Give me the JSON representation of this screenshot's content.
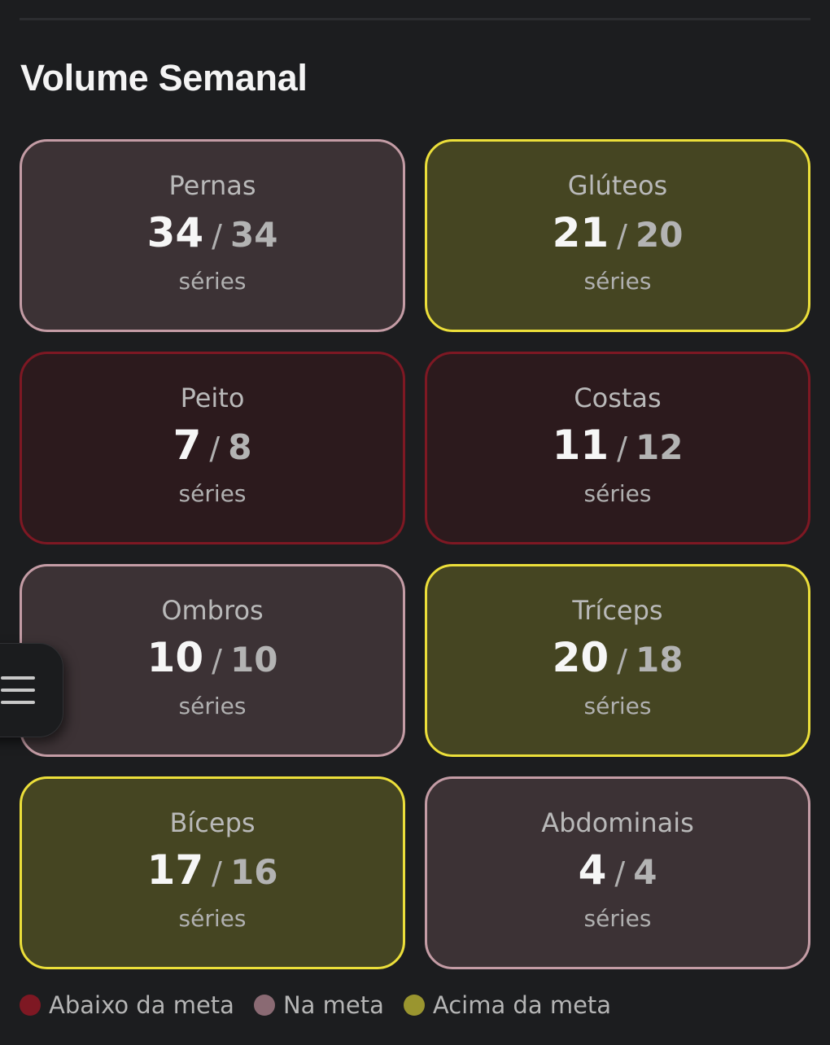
{
  "header": {
    "title": "Volume Semanal"
  },
  "colors": {
    "below": "#7e1823",
    "on_target": "#8a6a73",
    "above": "#9a952f"
  },
  "cards": [
    {
      "name": "Pernas",
      "done": "34",
      "target": "34",
      "unit": "séries",
      "status": "on"
    },
    {
      "name": "Glúteos",
      "done": "21",
      "target": "20",
      "unit": "séries",
      "status": "above"
    },
    {
      "name": "Peito",
      "done": "7",
      "target": "8",
      "unit": "séries",
      "status": "below"
    },
    {
      "name": "Costas",
      "done": "11",
      "target": "12",
      "unit": "séries",
      "status": "below"
    },
    {
      "name": "Ombros",
      "done": "10",
      "target": "10",
      "unit": "séries",
      "status": "on"
    },
    {
      "name": "Tríceps",
      "done": "20",
      "target": "18",
      "unit": "séries",
      "status": "above"
    },
    {
      "name": "Bíceps",
      "done": "17",
      "target": "16",
      "unit": "séries",
      "status": "above"
    },
    {
      "name": "Abdominais",
      "done": "4",
      "target": "4",
      "unit": "séries",
      "status": "on"
    }
  ],
  "separator": "/",
  "legend": [
    {
      "label": "Abaixo da meta",
      "color": "#7e1823"
    },
    {
      "label": "Na meta",
      "color": "#8a6a73"
    },
    {
      "label": "Acima da meta",
      "color": "#9a952f"
    }
  ],
  "menu": {
    "icon": "hamburger-menu-icon"
  }
}
